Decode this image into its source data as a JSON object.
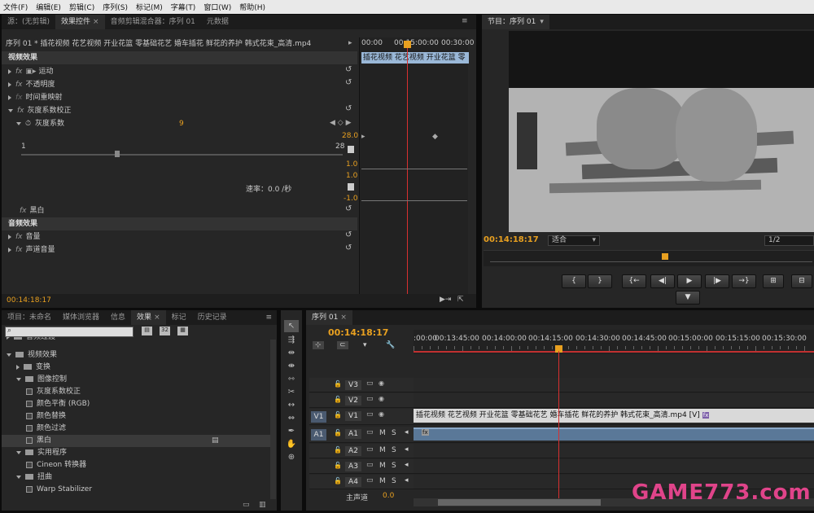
{
  "menu": [
    "文件(F)",
    "编辑(E)",
    "剪辑(C)",
    "序列(S)",
    "标记(M)",
    "字幕(T)",
    "窗口(W)",
    "帮助(H)"
  ],
  "left_tabs": [
    "源：(无剪辑)",
    "效果控件",
    "音频剪辑混合器：序列 01",
    "元数据"
  ],
  "effect_controls": {
    "clip_label": "序列 01 * 插花视频 花艺视频 开业花篮 零基础花艺 婚车插花 鲜花的养护 韩式花束_高清.mp4",
    "ruler": [
      "00:00",
      "00:15:00:00",
      "00:30:00"
    ],
    "clip_bar": "插花视频 花艺视频 开业花篮 零",
    "video_fx_header": "视频效果",
    "motion": "运动",
    "opacity": "不透明度",
    "time_remap": "时间重映射",
    "gamma_fx": "灰度系数校正",
    "gamma_param": "灰度系数",
    "gamma_value": "9",
    "slider_min": "1",
    "slider_max": "28",
    "graph_top": "28.0",
    "graph_v1": "1.0",
    "graph_v2": "1.0",
    "graph_bottom": "-1.0",
    "speed_label": "速率：0.0 /秒",
    "bw": "黑白",
    "audio_fx_header": "音频效果",
    "volume": "音量",
    "channel_volume": "声道音量",
    "timecode": "00:14:18:17"
  },
  "program": {
    "tab": "节目：序列 01",
    "timecode": "00:14:18:17",
    "fit": "适合",
    "resolution": "1/2",
    "transport": [
      "{",
      "}",
      "{←",
      "◀|",
      "▶",
      "|▶",
      "→}",
      "⊞",
      "⊟"
    ]
  },
  "project_tabs": [
    "项目：未命名",
    "媒体浏览器",
    "信息",
    "效果",
    "标记",
    "历史记录"
  ],
  "effects_tree": [
    {
      "label": "音频过渡",
      "indent": 0,
      "type": "folder"
    },
    {
      "label": "视频效果",
      "indent": 0,
      "type": "folder",
      "open": true
    },
    {
      "label": "变换",
      "indent": 1,
      "type": "folder"
    },
    {
      "label": "图像控制",
      "indent": 1,
      "type": "folder",
      "open": true
    },
    {
      "label": "灰度系数校正",
      "indent": 2,
      "type": "fx"
    },
    {
      "label": "颜色平衡 (RGB)",
      "indent": 2,
      "type": "fx"
    },
    {
      "label": "颜色替换",
      "indent": 2,
      "type": "fx"
    },
    {
      "label": "颜色过滤",
      "indent": 2,
      "type": "fx"
    },
    {
      "label": "黑白",
      "indent": 2,
      "type": "fx",
      "selected": true
    },
    {
      "label": "实用程序",
      "indent": 1,
      "type": "folder",
      "open": true
    },
    {
      "label": "Cineon 转换器",
      "indent": 2,
      "type": "fx"
    },
    {
      "label": "扭曲",
      "indent": 1,
      "type": "folder",
      "open": true
    },
    {
      "label": "Warp Stabilizer",
      "indent": 2,
      "type": "fx"
    }
  ],
  "timeline": {
    "tab": "序列 01",
    "timecode": "00:14:18:17",
    "ruler": [
      ":00:00",
      "00:13:45:00",
      "00:14:00:00",
      "00:14:15:00",
      "00:14:30:00",
      "00:14:45:00",
      "00:15:00:00",
      "00:15:15:00",
      "00:15:30:00"
    ],
    "video_tracks": [
      "V3",
      "V2",
      "V1"
    ],
    "audio_tracks": [
      "A1",
      "A2",
      "A3",
      "A4"
    ],
    "src_v": "V1",
    "src_a": "A1",
    "clip_label": "插花视频 花艺视频 开业花篮 零基础花艺 婚车插花 鲜花的养护 韩式花束_高清.mp4 [V]",
    "master": "主声道",
    "master_val": "0.0"
  },
  "watermark": "GAME773.com",
  "colors": {
    "accent": "#e8a020",
    "playhead": "#d83030",
    "clip": "#9ab8d8"
  }
}
